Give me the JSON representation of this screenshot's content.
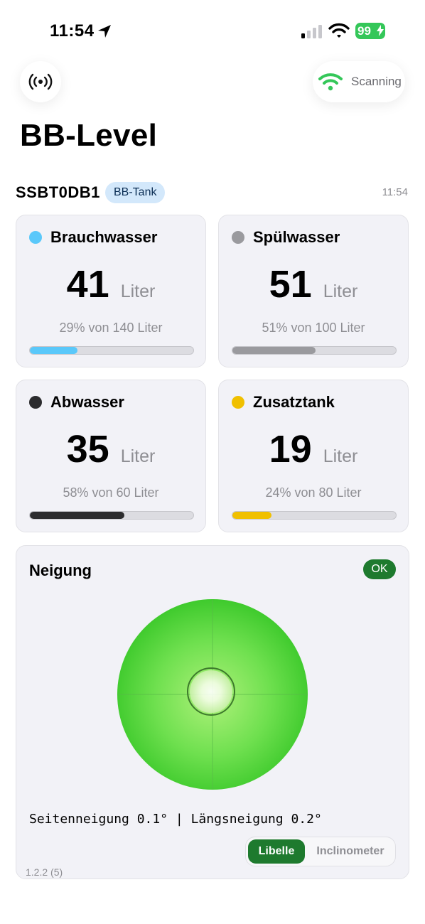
{
  "status_bar": {
    "time": "11:54",
    "battery": "99"
  },
  "header": {
    "scan_label": "Scanning",
    "title": "BB-Level"
  },
  "device": {
    "id": "SSBT0DB1",
    "badge": "BB-Tank",
    "time": "11:54"
  },
  "tanks": [
    {
      "name": "Brauchwasser",
      "value": "41",
      "unit": "Liter",
      "percent_text": "29% von 140 Liter",
      "fill_fraction": 0.29,
      "color": "#5ac8fa"
    },
    {
      "name": "Spülwasser",
      "value": "51",
      "unit": "Liter",
      "percent_text": "51% von 100 Liter",
      "fill_fraction": 0.51,
      "color": "#9a9a9e"
    },
    {
      "name": "Abwasser",
      "value": "35",
      "unit": "Liter",
      "percent_text": "58% von 60 Liter",
      "fill_fraction": 0.58,
      "color": "#2c2c2e"
    },
    {
      "name": "Zusatztank",
      "value": "19",
      "unit": "Liter",
      "percent_text": "24% von 80 Liter",
      "fill_fraction": 0.24,
      "color": "#f0c000"
    }
  ],
  "tilt": {
    "title": "Neigung",
    "status": "OK",
    "readout": "Seitenneigung 0.1° | Längsneigung 0.2°",
    "modes": [
      "Libelle",
      "Inclinometer"
    ],
    "active_mode": "Libelle",
    "version": "1.2.2 (5)"
  },
  "colors": {
    "accent_green": "#1e7a2e",
    "level_green": "#4cd137",
    "badge_blue": "#d3e8fb"
  },
  "icons": {
    "left_button": "antenna-icon",
    "scan": "wifi-icon",
    "location": "location-arrow-icon"
  }
}
